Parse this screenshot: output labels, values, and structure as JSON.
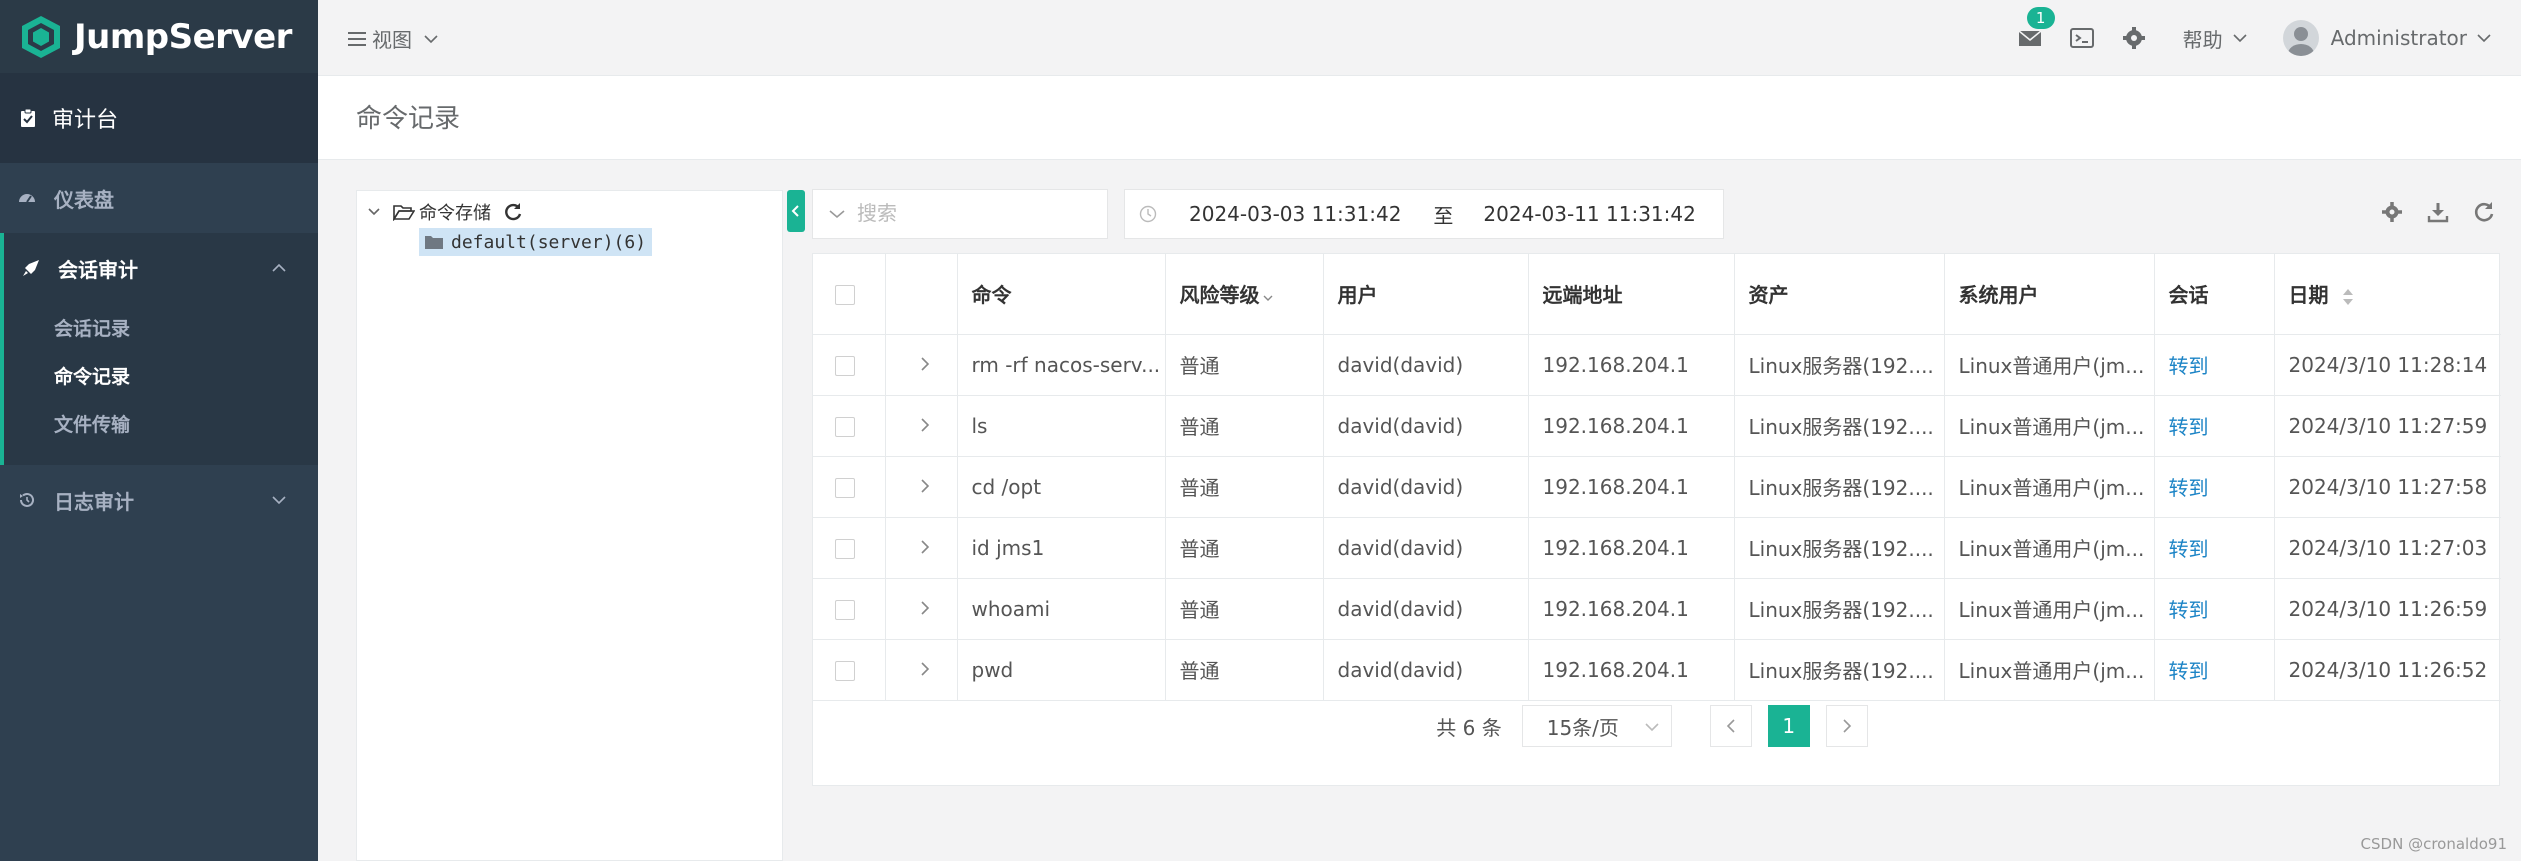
{
  "app": {
    "name": "JumpServer"
  },
  "sidebar": {
    "top_item": "审计台",
    "items": [
      {
        "label": "仪表盘",
        "expanded": false
      },
      {
        "label": "会话审计",
        "expanded": true,
        "children": [
          "会话记录",
          "命令记录",
          "文件传输"
        ]
      },
      {
        "label": "日志审计",
        "expanded": false
      }
    ]
  },
  "topbar": {
    "view_label": "视图",
    "notification_count": "1",
    "help_label": "帮助",
    "user_name": "Administrator"
  },
  "page": {
    "title": "命令记录"
  },
  "tree": {
    "root_label": "命令存储",
    "child_label": "default(server)(6)"
  },
  "toolbar": {
    "search_placeholder": "搜索",
    "date_from": "2024-03-03 11:31:42",
    "date_sep": "至",
    "date_to": "2024-03-11 11:31:42"
  },
  "table": {
    "columns": [
      "命令",
      "风险等级",
      "用户",
      "远端地址",
      "资产",
      "系统用户",
      "会话",
      "日期"
    ],
    "rows": [
      {
        "command": "rm -rf nacos-serv...",
        "risk": "普通",
        "user": "david(david)",
        "remote": "192.168.204.1",
        "asset": "Linux服务器(192....",
        "sysuser": "Linux普通用户(jm...",
        "session": "转到",
        "date": "2024/3/10 11:28:14"
      },
      {
        "command": "ls",
        "risk": "普通",
        "user": "david(david)",
        "remote": "192.168.204.1",
        "asset": "Linux服务器(192....",
        "sysuser": "Linux普通用户(jm...",
        "session": "转到",
        "date": "2024/3/10 11:27:59"
      },
      {
        "command": "cd /opt",
        "risk": "普通",
        "user": "david(david)",
        "remote": "192.168.204.1",
        "asset": "Linux服务器(192....",
        "sysuser": "Linux普通用户(jm...",
        "session": "转到",
        "date": "2024/3/10 11:27:58"
      },
      {
        "command": "id jms1",
        "risk": "普通",
        "user": "david(david)",
        "remote": "192.168.204.1",
        "asset": "Linux服务器(192....",
        "sysuser": "Linux普通用户(jm...",
        "session": "转到",
        "date": "2024/3/10 11:27:03"
      },
      {
        "command": "whoami",
        "risk": "普通",
        "user": "david(david)",
        "remote": "192.168.204.1",
        "asset": "Linux服务器(192....",
        "sysuser": "Linux普通用户(jm...",
        "session": "转到",
        "date": "2024/3/10 11:26:59"
      },
      {
        "command": "pwd",
        "risk": "普通",
        "user": "david(david)",
        "remote": "192.168.204.1",
        "asset": "Linux服务器(192....",
        "sysuser": "Linux普通用户(jm...",
        "session": "转到",
        "date": "2024/3/10 11:26:52"
      }
    ]
  },
  "pagination": {
    "total": "共 6 条",
    "page_size": "15条/页",
    "current_page": "1"
  },
  "watermark": "CSDN @cronaldo91",
  "colors": {
    "accent": "#1ab394",
    "sidebar": "#2f4050",
    "link": "#1c84c6"
  }
}
